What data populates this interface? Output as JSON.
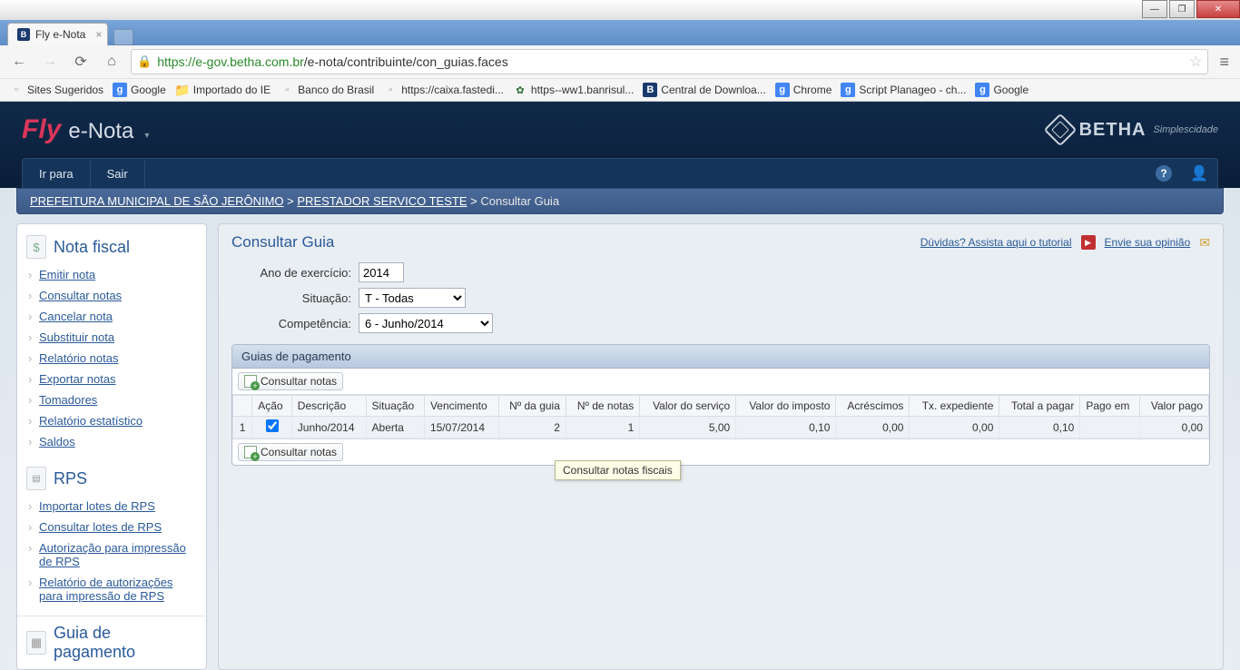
{
  "browser": {
    "tab_title": "Fly e-Nota",
    "url_host": "https://e-gov.betha.com.br",
    "url_path": "/e-nota/contribuinte/con_guias.faces",
    "bookmarks": [
      {
        "label": "Sites Sugeridos",
        "icon": "page"
      },
      {
        "label": "Google",
        "icon": "g"
      },
      {
        "label": "Importado do IE",
        "icon": "folder"
      },
      {
        "label": "Banco do Brasil",
        "icon": "page"
      },
      {
        "label": "https://caixa.fastedi...",
        "icon": "page"
      },
      {
        "label": "https--ww1.banrisul...",
        "icon": "bk"
      },
      {
        "label": "Central de Downloa...",
        "icon": "b"
      },
      {
        "label": "Chrome",
        "icon": "g"
      },
      {
        "label": "Script Planageo - ch...",
        "icon": "g"
      },
      {
        "label": "Google",
        "icon": "g"
      }
    ]
  },
  "brand": {
    "fly": "Fly",
    "enota": "e-Nota",
    "betha": "BETHA",
    "tag": "Simplescidade"
  },
  "topmenu": {
    "irpara": "Ir para",
    "sair": "Sair"
  },
  "breadcrumb": {
    "a": "PREFEITURA MUNICIPAL DE SÃO JERÔNIMO",
    "b": "PRESTADOR SERVICO TESTE",
    "c": "Consultar Guia"
  },
  "sidebar": {
    "nota_fiscal": {
      "title": "Nota fiscal",
      "items": [
        "Emitir nota",
        "Consultar notas",
        "Cancelar nota",
        "Substituir nota",
        "Relatório notas",
        "Exportar notas",
        "Tomadores",
        "Relatório estatístico",
        "Saldos"
      ]
    },
    "rps": {
      "title": "RPS",
      "items": [
        "Importar lotes de RPS",
        "Consultar lotes de RPS",
        "Autorização para impressão de RPS",
        "Relatório de autorizações para impressão de RPS"
      ]
    },
    "guia": {
      "title": "Guia de pagamento"
    }
  },
  "main": {
    "title": "Consultar Guia",
    "help": "Dúvidas? Assista aqui o tutorial",
    "opinion": "Envie sua opinião",
    "labels": {
      "ano": "Ano de exercício:",
      "situacao": "Situação:",
      "competencia": "Competência:"
    },
    "values": {
      "ano": "2014",
      "situacao": "T - Todas",
      "competencia": "6 - Junho/2014"
    },
    "panel_title": "Guias de pagamento",
    "tool_btn": "Consultar notas",
    "headers": [
      "",
      "Ação",
      "Descrição",
      "Situação",
      "Vencimento",
      "Nº da guia",
      "Nº de notas",
      "Valor do serviço",
      "Valor do imposto",
      "Acréscimos",
      "Tx. expediente",
      "Total a pagar",
      "Pago em",
      "Valor pago"
    ],
    "row": {
      "idx": "1",
      "descricao": "Junho/2014",
      "situacao": "Aberta",
      "vencimento": "15/07/2014",
      "num_guia": "2",
      "num_notas": "1",
      "valor_servico": "5,00",
      "valor_imposto": "0,10",
      "acrescimos": "0,00",
      "tx_exp": "0,00",
      "total": "0,10",
      "pago_em": "",
      "valor_pago": "0,00"
    },
    "tooltip": "Consultar notas fiscais"
  }
}
